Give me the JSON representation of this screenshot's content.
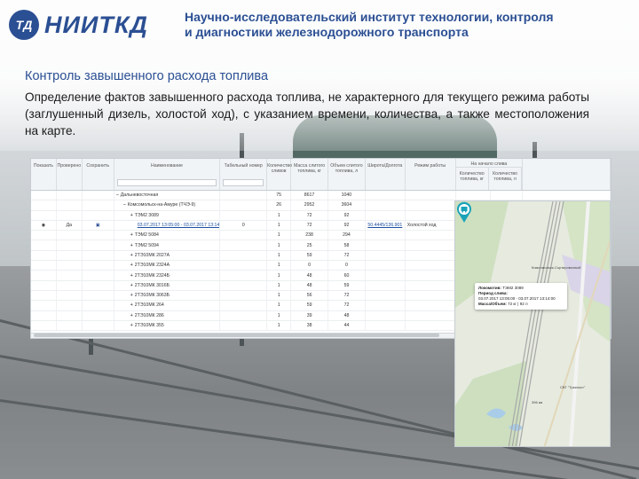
{
  "logo": {
    "mark": "ТД",
    "text": "НИИТКД"
  },
  "institute_name": "Научно-исследовательский институт технологии, контроля и диагностики железнодорожного транспорта",
  "section_title": "Контроль завышенного расхода топлива",
  "description": "Определение фактов завышенного расхода топлива, не характерного для текущего режима работы (заглушенный дизель, холостой ход), с указанием времени, количества, а также местоположения на карте.",
  "table": {
    "headers": {
      "show": "Показать",
      "checked": "Проверено",
      "save": "Сохранить",
      "name": "Наименование",
      "tab_number": "Табельный номер",
      "drain_count": "Количество сливов",
      "fuel_mass": "Масса слитого топлива, кг",
      "fuel_volume": "Объем слитого топлива, л",
      "coords": "Широта/Долгота",
      "mode": "Режим работы",
      "group": "На начало слива",
      "group_count": "Количество топлива, кг",
      "group_mass": "Количество топлива, л"
    },
    "rows": [
      {
        "name": "Дальневосточная",
        "count": "75",
        "mass": "8617",
        "volume": "1040",
        "level": 0
      },
      {
        "name": "Комсомольск-на-Амуре (ТЧЭ-9)",
        "count": "26",
        "mass": "2952",
        "volume": "3604",
        "level": 1
      },
      {
        "name": "ТЭМ2 3089",
        "count": "1",
        "mass": "72",
        "volume": "92",
        "level": 2
      },
      {
        "name": "03.07.2017 13:05:00 - 03.07.2017 13:14:00",
        "tab": "0",
        "count": "1",
        "mass": "72",
        "volume": "92",
        "coords": "50.4445/136.901",
        "mode": "Холостой ход",
        "checked": "Да",
        "level": 3
      },
      {
        "name": "ТЭМ2 5084",
        "count": "1",
        "mass": "238",
        "volume": "294",
        "level": 2
      },
      {
        "name": "ТЭМ2 5094",
        "count": "1",
        "mass": "25",
        "volume": "58",
        "level": 2
      },
      {
        "name": "2ТЭ10МК 2027А",
        "count": "1",
        "mass": "59",
        "volume": "72",
        "level": 2
      },
      {
        "name": "2ТЭ10МК 2324А",
        "count": "1",
        "mass": "0",
        "volume": "0",
        "level": 2
      },
      {
        "name": "2ТЭ10МК 2324Б",
        "count": "1",
        "mass": "48",
        "volume": "60",
        "level": 2
      },
      {
        "name": "2ТЭ10МК 3016Б",
        "count": "1",
        "mass": "48",
        "volume": "59",
        "level": 2
      },
      {
        "name": "2ТЭ10МК 3063Б",
        "count": "1",
        "mass": "56",
        "volume": "72",
        "level": 2
      },
      {
        "name": "2ТЭ10МК 264",
        "count": "1",
        "mass": "59",
        "volume": "72",
        "level": 2
      },
      {
        "name": "2ТЭ10МК 286",
        "count": "1",
        "mass": "39",
        "volume": "48",
        "level": 2
      },
      {
        "name": "2ТЭ10МК 355",
        "count": "1",
        "mass": "38",
        "volume": "44",
        "level": 2
      }
    ]
  },
  "map": {
    "station_label": "Комсомольск-Сортировочный",
    "popup": {
      "loco_label": "Локомотив:",
      "loco": "ТЭМ2 3089",
      "period_label": "Период слива:",
      "period": "03.07.2017 13:05:00 - 03.07.2017 13:14:00",
      "mass_label": "Масса/Объем:",
      "mass": "72 кг | 92 л"
    },
    "label_east": "СВТ \"Трекпост\"",
    "label_km": "396 км",
    "icon": "locomotive-marker-icon"
  }
}
